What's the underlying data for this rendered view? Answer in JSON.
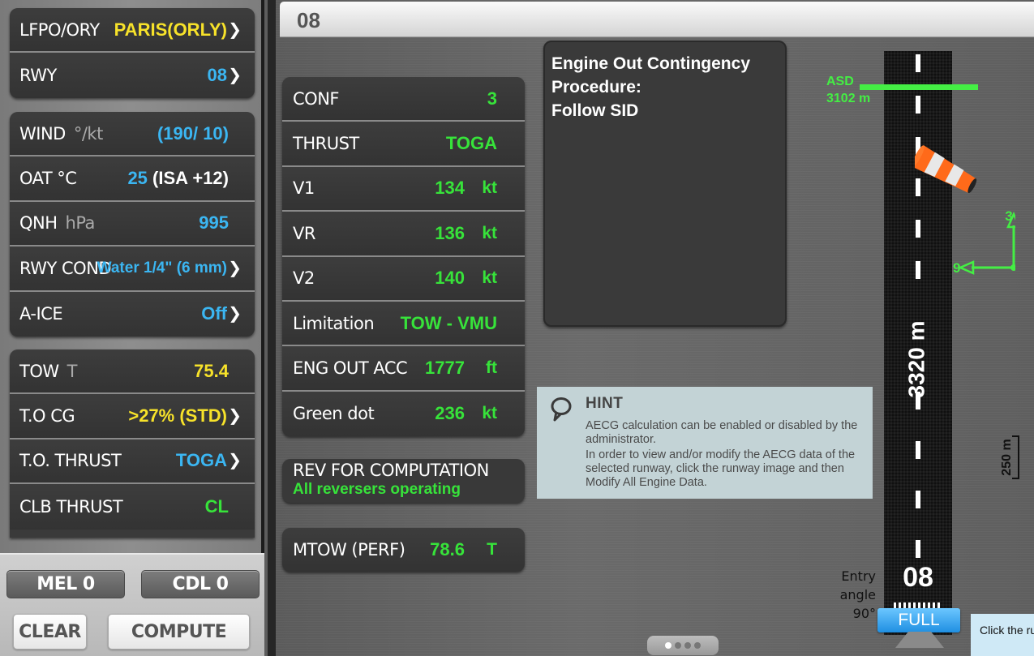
{
  "left": {
    "airport": {
      "code": "LFPO/ORY",
      "name": "PARIS(ORLY)"
    },
    "runway": {
      "label": "RWY",
      "value": "08"
    },
    "conditions": [
      {
        "label": "WIND",
        "unit": "°/kt",
        "value": "(190/ 10)"
      },
      {
        "label": "OAT",
        "unit": "°C",
        "value": "25",
        "value2": "(ISA +12)"
      },
      {
        "label": "QNH",
        "unit": "hPa",
        "value": "995"
      },
      {
        "label": "RWY COND",
        "unit": "",
        "value": "Water 1/4\" (6 mm)"
      },
      {
        "label": "A-ICE",
        "unit": "",
        "value": "Off"
      }
    ],
    "aircraft": [
      {
        "label": "TOW",
        "unit": "T",
        "value": "75.4"
      },
      {
        "label": "T.O CG",
        "unit": "",
        "value": ">27% (STD)"
      },
      {
        "label": "T.O. THRUST",
        "unit": "",
        "value": "TOGA"
      },
      {
        "label": "CLB THRUST",
        "unit": "",
        "value": "CL"
      }
    ],
    "buttons": {
      "mel": "MEL 0",
      "cdl": "CDL 0",
      "clear": "CLEAR",
      "compute": "COMPUTE"
    }
  },
  "main": {
    "title": "08",
    "results": [
      {
        "label": "CONF",
        "value": "3",
        "unit": ""
      },
      {
        "label": "THRUST",
        "value": "TOGA",
        "unit": ""
      },
      {
        "label": "V1",
        "value": "134",
        "unit": "kt"
      },
      {
        "label": "VR",
        "value": "136",
        "unit": "kt"
      },
      {
        "label": "V2",
        "value": "140",
        "unit": "kt"
      },
      {
        "label": "Limitation",
        "value": "TOW - VMU",
        "unit": ""
      },
      {
        "label": "ENG OUT ACC",
        "value": "1777",
        "unit": "ft"
      },
      {
        "label": "Green dot",
        "value": "236",
        "unit": "kt"
      }
    ],
    "rev": {
      "label": "REV FOR COMPUTATION",
      "value": "All reversers operating"
    },
    "mtow": {
      "label": "MTOW (PERF)",
      "value": "78.6",
      "unit": "T"
    },
    "eoc": {
      "line1": "Engine Out Contingency",
      "line2": "Procedure:",
      "line3": "Follow SID"
    },
    "hint": {
      "title": "HINT",
      "p1": "AECG calculation can be enabled or disabled by the administrator.",
      "p2": "In order to view and/or modify the AECG data of the selected runway, click the runway image and then Modify All Engine Data."
    },
    "runway_graphic": {
      "length": "3320 m",
      "number": "08",
      "asd_label": "ASD",
      "asd_value": "3102 m",
      "entry_line1": "Entry",
      "entry_line2": "angle",
      "entry_line3": "90°",
      "full_button": "FULL",
      "compass_up": "3",
      "compass_left": "9",
      "scale": "250 m"
    },
    "tooltip": "Click the rur",
    "colors": {
      "green": "#37e33a",
      "yellow": "#f7e22a",
      "blue": "#3bb6f2"
    }
  }
}
